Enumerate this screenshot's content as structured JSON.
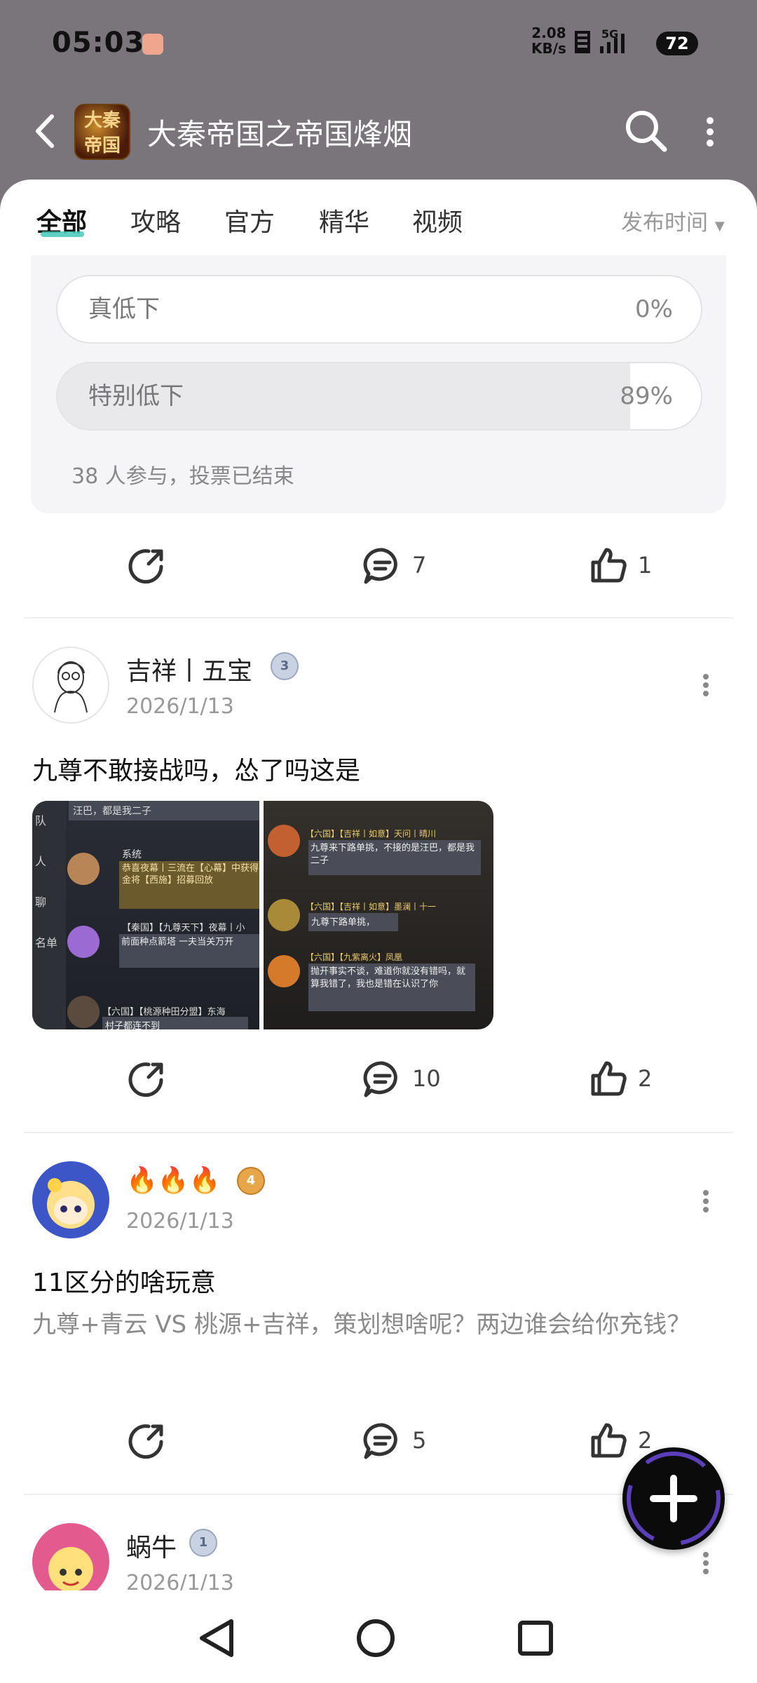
{
  "status_bar": {
    "time": "05:03",
    "net_speed_value": "2.08",
    "net_speed_unit": "KB/s",
    "network": "5G",
    "battery": "72"
  },
  "header": {
    "title": "大秦帝国之帝国烽烟",
    "icon_text": "大秦帝国"
  },
  "tabs": [
    {
      "label": "全部",
      "active": true
    },
    {
      "label": "攻略",
      "active": false
    },
    {
      "label": "官方",
      "active": false
    },
    {
      "label": "精华",
      "active": false
    },
    {
      "label": "视频",
      "active": false
    }
  ],
  "sort_label": "发布时间",
  "poll": {
    "options": [
      {
        "label": "真低下",
        "percent_text": "0%",
        "fraction": 0.0
      },
      {
        "label": "特别低下",
        "percent_text": "89%",
        "fraction": 0.89
      }
    ],
    "info": "38 人参与，投票已结束"
  },
  "poll_post_actions": {
    "comments": "7",
    "likes": "1"
  },
  "posts": [
    {
      "username": "吉祥丨五宝",
      "level": "3",
      "date": "2026/1/13",
      "title": "九尊不敢接战吗，怂了吗这是",
      "comments": "10",
      "likes": "2",
      "images": [
        {
          "side_tabs": [
            "队",
            "人",
            "聊",
            "名单"
          ],
          "messages": [
            {
              "top_fragment": "汪巴，都是我二子"
            },
            {
              "sender": "系统",
              "text": "恭喜夜幕丨三流在【心幕】中获得金将【西施】招募回放"
            },
            {
              "sender": "【秦国】【九尊天下】夜幕丨小",
              "text": "前面种点箭塔  一夫当关万开"
            },
            {
              "sender": "【六国】【桃源种田分盟】东海",
              "text": "村子都连不到"
            }
          ]
        },
        {
          "messages": [
            {
              "sender": "【六国】【吉祥丨如意】天问丨晴川",
              "text": "九尊来下路单挑，不接的是汪巴，都是我二子"
            },
            {
              "sender": "【六国】【吉祥丨如意】墨澜丨十一",
              "text": "九尊下路单挑，"
            },
            {
              "sender": "【六国】【九紫离火】凤凰",
              "text": "抛开事实不谈，难道你就没有错吗，就算我错了，我也是错在认识了你"
            }
          ]
        }
      ]
    },
    {
      "username": "🔥🔥🔥",
      "level": "4",
      "date": "2026/1/13",
      "title": "11区分的啥玩意",
      "body": "九尊+青云 VS 桃源+吉祥，策划想啥呢？两边谁会给你充钱？",
      "comments": "5",
      "likes": "2"
    },
    {
      "username": "蜗牛",
      "level": "1",
      "date": "2026/1/13"
    }
  ],
  "colors": {
    "accent": "#45c9b8",
    "header_bg": "#79757a",
    "poll_bg": "#f5f5f7"
  },
  "icons": [
    "back-icon",
    "search-icon",
    "more-vert-icon",
    "share-icon",
    "comment-icon",
    "like-icon",
    "plus-icon",
    "nav-back-icon",
    "nav-home-icon",
    "nav-recents-icon"
  ]
}
